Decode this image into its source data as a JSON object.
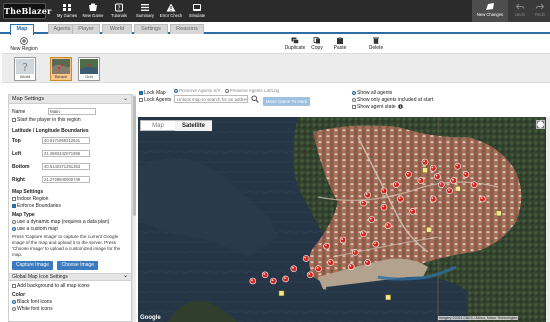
{
  "app": {
    "logo": "TheBlazer"
  },
  "toolbar": {
    "my_games": "My Games",
    "new_game": "New Game",
    "tutorials": "Tutorials",
    "summary": "Summary",
    "error_check": "Error Check",
    "simulate": "Simulate",
    "new_changes": "New Changes",
    "undo": "Undo",
    "redo": "Redo"
  },
  "tabs": [
    "Map",
    "Agents",
    "Player",
    "World",
    "Settings",
    "Reasons"
  ],
  "actions": {
    "new_region": "New Region",
    "duplicate": "Duplicate",
    "copy": "Copy",
    "paste": "Paste",
    "delete": "Delete"
  },
  "regions": [
    {
      "label": "World"
    },
    {
      "label": "Bleach"
    },
    {
      "label": "Grid"
    }
  ],
  "map_settings": {
    "header": "Map Settings",
    "name_label": "Name",
    "name_value": "Main",
    "start_player_label": "Start the player in this region",
    "latlng_header": "Latitude / Longitude Boundaries",
    "top_label": "Top",
    "top_value": "40.5171958312631",
    "left_label": "Left",
    "left_value": "21.2683432071959",
    "bottom_label": "Bottom",
    "bottom_value": "40.5140371261353",
    "right_label": "Right",
    "right_value": "21.2729840900749",
    "map_settings_sub": "Map Settings",
    "indoor_region": "Indoor Region",
    "enforce_boundaries": "Enforce Boundaries",
    "map_type_header": "Map Type",
    "map_type_dynamic": "use a dynamic map (requires a data plan)",
    "map_type_custom": "use a custom map",
    "instructions": "Press 'Capture Image' to capture the current Google image of the map and upload it to the server. Press 'Choose Image' to upload a customized image for the map.",
    "capture_image": "Capture Image",
    "choose_image": "Choose Image",
    "global_icon_header": "Global Map Icon Settings",
    "add_background": "Add background to all map icons",
    "color_header": "Color",
    "black_icons": "Black font icons",
    "white_icons": "White font icons"
  },
  "map_options": {
    "lock_map": "Lock Map",
    "lock_agents": "Lock Agents",
    "preserve_agents_xy": "Preserve Agents X/Y",
    "preserve_agents_latlng": "Preserve Agents Lat/Lng",
    "search_placeholder": "Unlock map to search for an address",
    "move_btn": "Move Game To Here",
    "show_all_agents": "Show all agents",
    "show_only_agents": "Show only agents included at start",
    "show_agent_state": "Show agent state"
  },
  "map": {
    "type_map": "Map",
    "type_satellite": "Satellite",
    "google_logo": "Google",
    "attribution": "Imagery ©2021 CNES / Airbus, Maxar Technologies"
  },
  "markers": {
    "red": [
      [
        0.7,
        0.22
      ],
      [
        0.72,
        0.25
      ],
      [
        0.73,
        0.29
      ],
      [
        0.69,
        0.31
      ],
      [
        0.74,
        0.33
      ],
      [
        0.78,
        0.24
      ],
      [
        0.8,
        0.28
      ],
      [
        0.77,
        0.31
      ],
      [
        0.6,
        0.36
      ],
      [
        0.56,
        0.38
      ],
      [
        0.55,
        0.42
      ],
      [
        0.6,
        0.44
      ],
      [
        0.64,
        0.4
      ],
      [
        0.67,
        0.46
      ],
      [
        0.57,
        0.5
      ],
      [
        0.61,
        0.53
      ],
      [
        0.55,
        0.57
      ],
      [
        0.58,
        0.62
      ],
      [
        0.53,
        0.66
      ],
      [
        0.5,
        0.6
      ],
      [
        0.46,
        0.63
      ],
      [
        0.47,
        0.71
      ],
      [
        0.41,
        0.69
      ],
      [
        0.38,
        0.74
      ],
      [
        0.42,
        0.77
      ],
      [
        0.36,
        0.79
      ],
      [
        0.33,
        0.8
      ],
      [
        0.28,
        0.8
      ],
      [
        0.31,
        0.77
      ],
      [
        0.56,
        0.71
      ],
      [
        0.52,
        0.73
      ],
      [
        0.76,
        0.36
      ],
      [
        0.82,
        0.33
      ],
      [
        0.84,
        0.4
      ],
      [
        0.72,
        0.4
      ],
      [
        0.66,
        0.28
      ],
      [
        0.63,
        0.33
      ],
      [
        0.44,
        0.74
      ]
    ],
    "yellow": [
      [
        0.7,
        0.26
      ],
      [
        0.78,
        0.35
      ],
      [
        0.88,
        0.47
      ],
      [
        0.71,
        0.55
      ],
      [
        0.35,
        0.86
      ],
      [
        0.61,
        0.88
      ]
    ]
  },
  "colors": {
    "accent": "#2e6da4",
    "marker": "#d7261e",
    "topbar": "#2b2b2b"
  }
}
